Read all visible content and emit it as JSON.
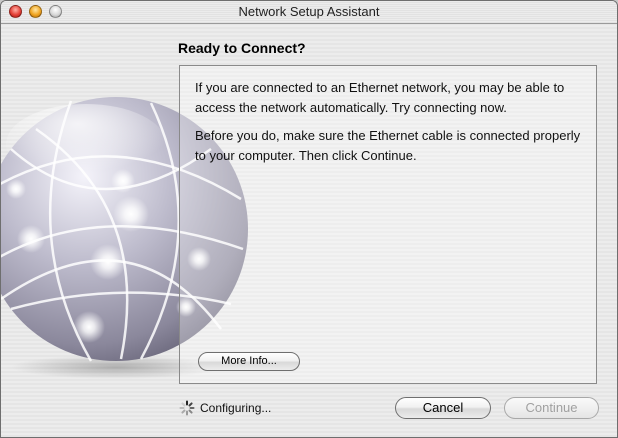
{
  "window": {
    "title": "Network Setup Assistant"
  },
  "content": {
    "heading": "Ready to Connect?",
    "paragraph1": "If you are connected to an Ethernet network, you may be able to access the network automatically. Try connecting now.",
    "paragraph2": "Before you do, make sure the Ethernet cable is connected properly to your computer. Then click Continue.",
    "more_info_label": "More Info..."
  },
  "footer": {
    "status_text": "Configuring...",
    "cancel_label": "Cancel",
    "continue_label": "Continue",
    "continue_enabled": false
  },
  "icons": {
    "globe": "network-globe-icon",
    "spinner": "progress-spinner-icon"
  }
}
